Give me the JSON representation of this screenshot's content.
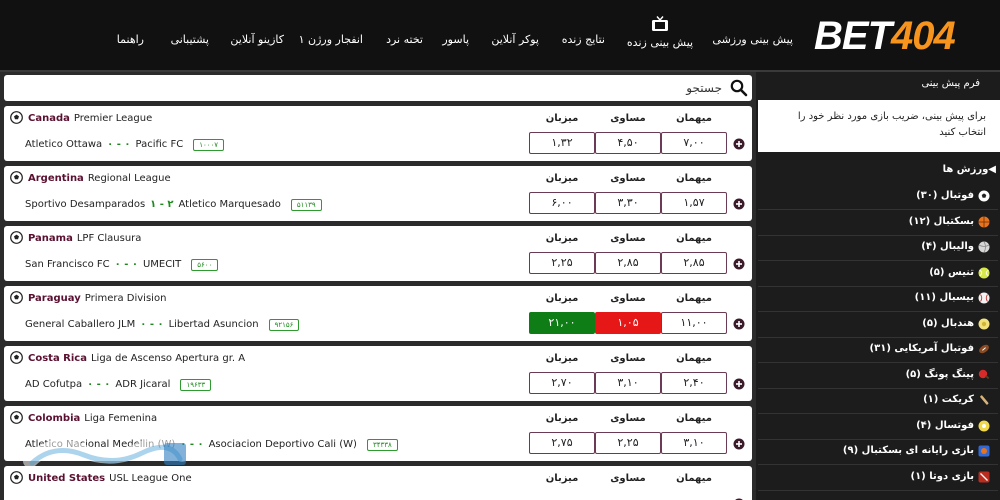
{
  "header": {
    "logo_text_white": "BET",
    "logo_text_orange": "404",
    "nav": {
      "sports_predictions": "پیش بینی ورزشی",
      "live_predictions": "پیش بینی زنده",
      "live_results": "نتایج زنده",
      "online_poker": "پوکر آنلاین",
      "pasur": "پاسور",
      "backgammon": "تخته نرد",
      "crash_v1": "انفجار ورژن ۱",
      "online_casino": "کازینو آنلاین",
      "support": "پشتیبانی",
      "guide": "راهنما"
    },
    "icons": {
      "live_tv": "tv-icon"
    }
  },
  "search": {
    "placeholder": "جستجو",
    "icon": "search-icon"
  },
  "colors": {
    "header_bg": "#111111",
    "page_bg": "#2b2b2b",
    "sidebar_bg": "#1c1c1c",
    "logo_orange": "#f7941d",
    "odd_border": "#6b3a55",
    "odd_green": "#0f7d16",
    "odd_red": "#e51717",
    "league_country": "#5a1030"
  },
  "odds_labels": {
    "away": "میهمان",
    "draw": "مساوی",
    "home": "میزبان"
  },
  "matches": [
    {
      "country": "Canada",
      "league": "Premier League",
      "home": "Atletico Ottawa",
      "score": "۰ - ۰",
      "away": "Pacific FC",
      "match_id": "۱۰۰۰۷",
      "odds": {
        "away": "۷,۰۰",
        "draw": "۴,۵۰",
        "home": "۱,۳۲"
      }
    },
    {
      "country": "Argentina",
      "league": "Regional League",
      "home": "Sportivo Desamparados",
      "score": "۱ - ۲",
      "away": "Atletico Marquesado",
      "match_id": "۵۱۱۳۹",
      "odds": {
        "away": "۱,۵۷",
        "draw": "۳,۳۰",
        "home": "۶,۰۰"
      }
    },
    {
      "country": "Panama",
      "league": "LPF Clausura",
      "home": "San Francisco FC",
      "score": "۰ - ۰",
      "away": "UMECIT",
      "match_id": "۵۶۰۰",
      "odds": {
        "away": "۲,۸۵",
        "draw": "۲,۸۵",
        "home": "۲,۲۵"
      }
    },
    {
      "country": "Paraguay",
      "league": "Primera Division",
      "home": "General Caballero JLM",
      "score": "۰ - ۰",
      "away": "Libertad Asuncion",
      "match_id": "۹۲۱۵۶",
      "odds": {
        "away": "۱۱,۰۰",
        "draw": "۱,۰۵",
        "home": "۲۱,۰۰"
      }
    },
    {
      "country": "Costa Rica",
      "league": "Liga de Ascenso Apertura gr. A",
      "home": "AD Cofutpa",
      "score": "۰ - ۰",
      "away": "ADR Jicaral",
      "match_id": "۱۹۶۳۳",
      "odds": {
        "away": "۲,۴۰",
        "draw": "۳,۱۰",
        "home": "۲,۷۰"
      }
    },
    {
      "country": "Colombia",
      "league": "Liga Femenina",
      "home": "Atletico Nacional Medellin (W)",
      "score": "۰ - ۰",
      "away": "Asociacion Deportivo Cali (W)",
      "match_id": "۳۴۳۳۸",
      "odds": {
        "away": "۳,۱۰",
        "draw": "۲,۲۵",
        "home": "۲,۷۵"
      }
    },
    {
      "country": "United States",
      "league": "USL League One",
      "home": "",
      "score": "",
      "away": "",
      "match_id": "",
      "odds": {
        "away": "",
        "draw": "",
        "home": ""
      }
    }
  ],
  "sidebar": {
    "betform_title": "فرم پیش بینی",
    "betform_message": "برای پیش بینی، ضریب بازی مورد نظر خود را انتخاب کنید",
    "sports_title": "ورزش ها",
    "sports": [
      {
        "label": "فوتبال (۳۰)",
        "icon": "soccer-ball-icon"
      },
      {
        "label": "بسکتبال (۱۲)",
        "icon": "basketball-icon"
      },
      {
        "label": "والیبال (۴)",
        "icon": "volleyball-icon"
      },
      {
        "label": "تنیس (۵)",
        "icon": "tennis-ball-icon"
      },
      {
        "label": "بیسبال (۱۱)",
        "icon": "baseball-icon"
      },
      {
        "label": "هندبال (۵)",
        "icon": "handball-icon"
      },
      {
        "label": "فوتبال آمریکایی (۳۱)",
        "icon": "american-football-icon"
      },
      {
        "label": "پینگ پونگ (۵)",
        "icon": "ping-pong-icon"
      },
      {
        "label": "کریکت (۱)",
        "icon": "cricket-bat-icon"
      },
      {
        "label": "فوتسال (۴)",
        "icon": "futsal-ball-icon"
      },
      {
        "label": "بازی رایانه ای بسکتبال (۹)",
        "icon": "esports-basketball-icon"
      },
      {
        "label": "بازی دوتا (۱)",
        "icon": "dota-icon"
      }
    ]
  },
  "watermark": {
    "icon": "watermark-logo"
  }
}
